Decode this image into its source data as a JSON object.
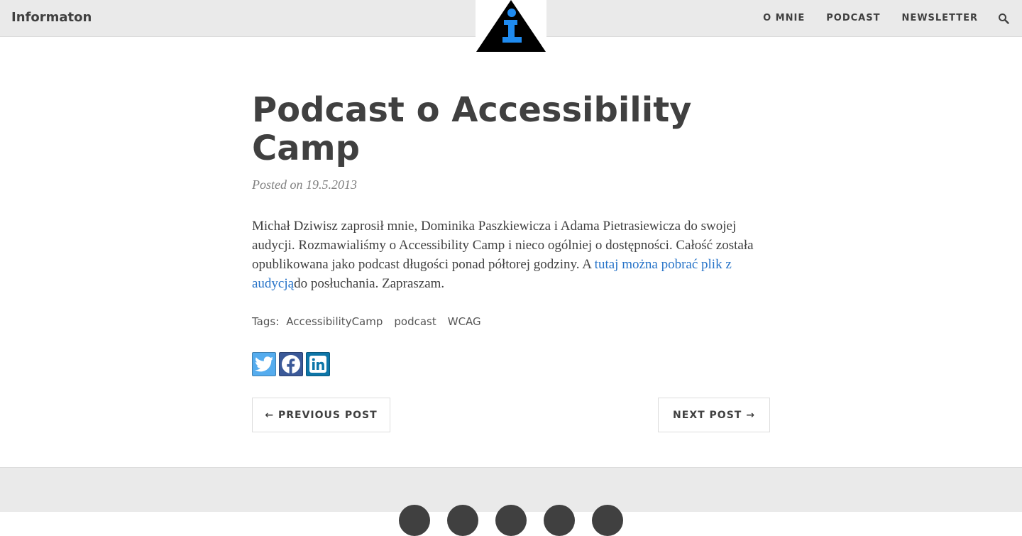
{
  "navbar": {
    "brand": "Informaton",
    "links": [
      "O MNIE",
      "PODCAST",
      "NEWSLETTER"
    ],
    "search_icon": "search-icon",
    "logo_icon": "info-triangle-logo"
  },
  "post": {
    "title": "Podcast o Accessibility Camp",
    "meta": "Posted on 19.5.2013",
    "body_part1": "Michał Dziwisz zaprosił mnie, Dominika Paszkiewicza i Adama Pietrasiewicza do swojej audycji. Rozmawialiśmy o Accessibility Camp i nieco ogólniej o dostępności. Całość została opublikowana jako podcast długości ponad półtorej godziny. A ",
    "body_link": "tutaj można pobrać plik z audycją",
    "body_part2": "do posłuchania. Zapraszam."
  },
  "tags": {
    "label": "Tags:",
    "items": [
      "AccessibilityCamp",
      "podcast",
      "WCAG"
    ]
  },
  "share": {
    "icons": [
      "twitter-icon",
      "facebook-icon",
      "linkedin-icon"
    ]
  },
  "pager": {
    "previous": "← PREVIOUS POST",
    "next": "NEXT POST →"
  },
  "colors": {
    "navbar_bg": "#eaeaea",
    "text": "#404040",
    "link": "#2673c8",
    "logo_blue": "#1f8bf0",
    "twitter": "#55acee",
    "facebook": "#3b5998",
    "linkedin": "#0e76a8"
  }
}
